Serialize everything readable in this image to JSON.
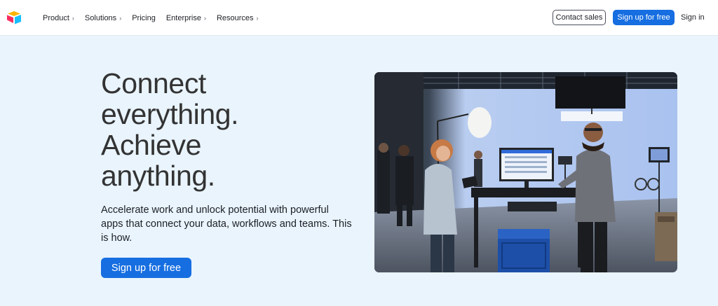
{
  "nav": {
    "logo_icon": "airtable-logo-icon",
    "items": [
      {
        "label": "Product",
        "has_chevron": true
      },
      {
        "label": "Solutions",
        "has_chevron": true
      },
      {
        "label": "Pricing",
        "has_chevron": false
      },
      {
        "label": "Enterprise",
        "has_chevron": true
      },
      {
        "label": "Resources",
        "has_chevron": true
      }
    ],
    "contact_sales": "Contact sales",
    "sign_up": "Sign up for free",
    "sign_in": "Sign in"
  },
  "hero": {
    "headline_lines": [
      "Connect",
      "everything.",
      "Achieve",
      "anything."
    ],
    "subtext": "Accelerate work and unlock potential with powerful apps that connect your data, workflows and teams. This is how.",
    "cta": "Sign up for free"
  },
  "colors": {
    "accent": "#166ee1",
    "hero_bg": "#e9f4fd",
    "headline": "#333333"
  }
}
